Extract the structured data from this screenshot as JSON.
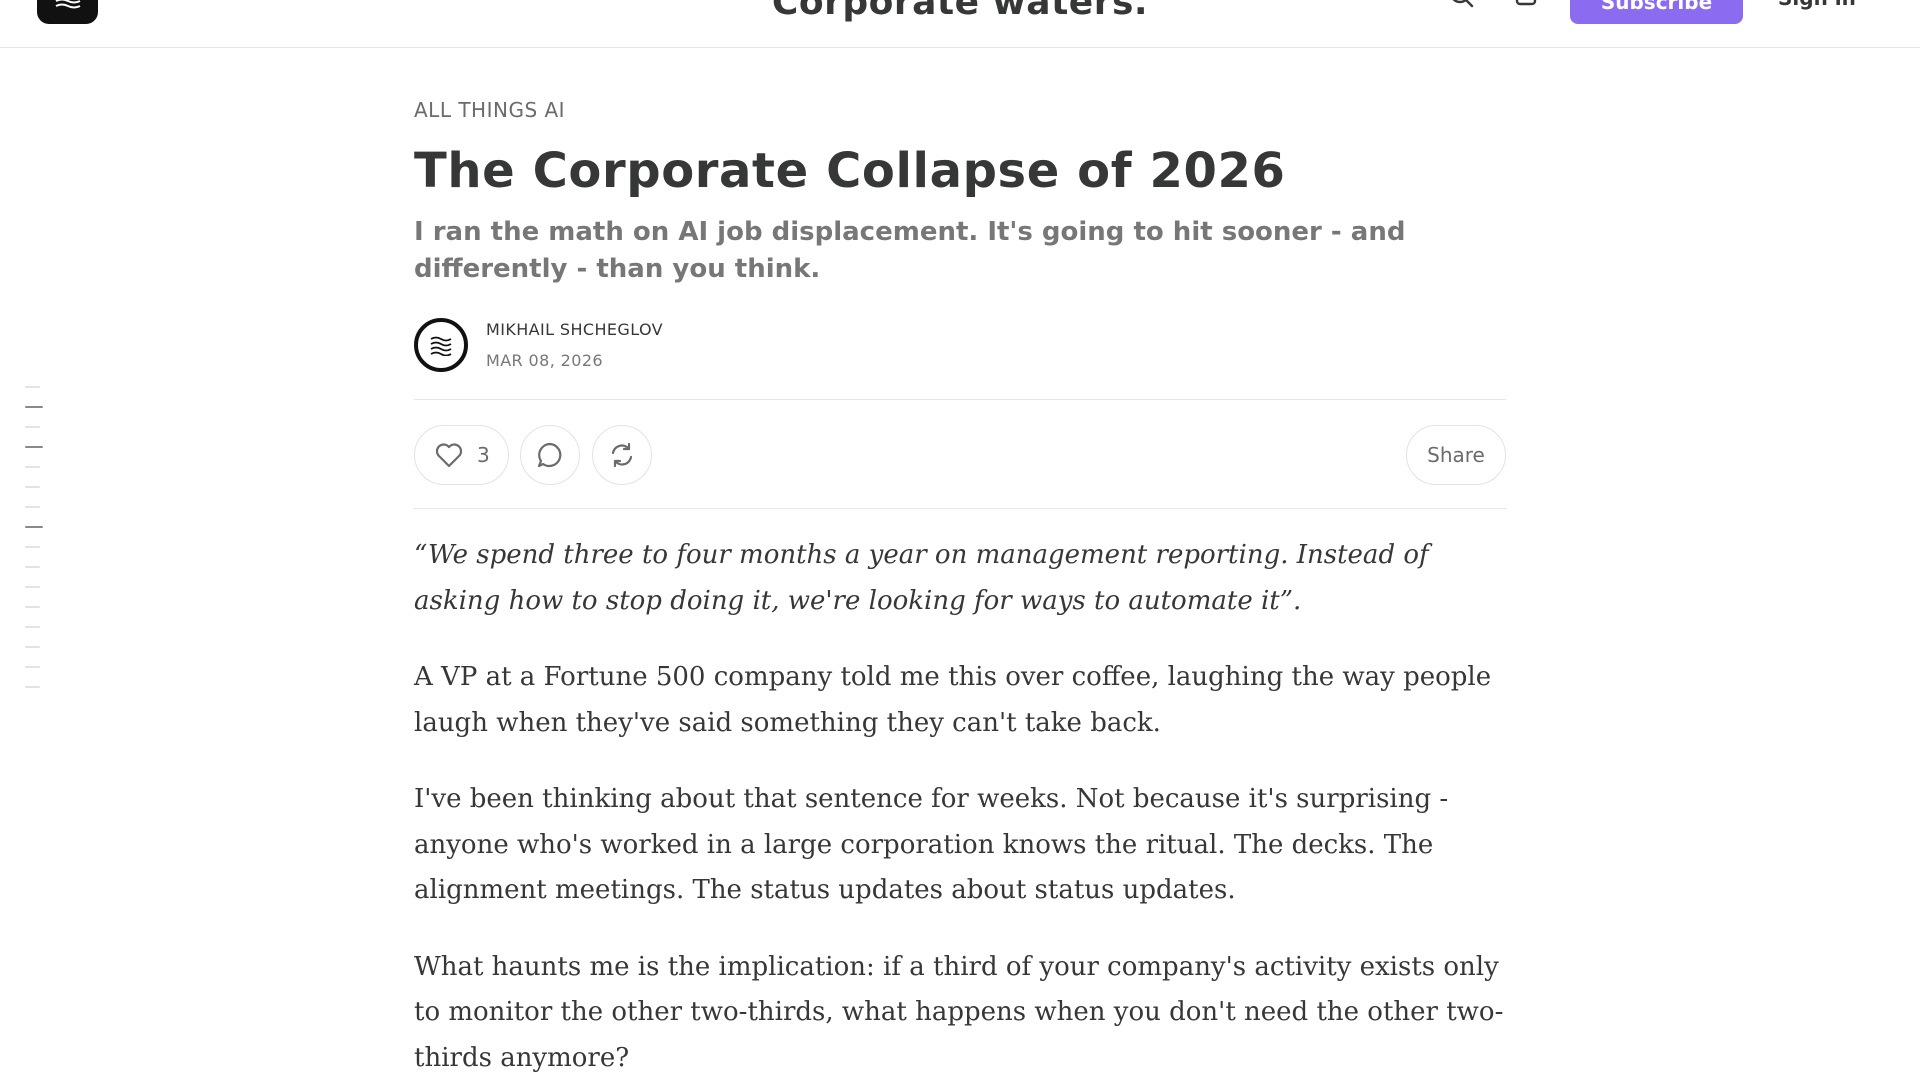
{
  "header": {
    "publication_title": "Corporate waters.",
    "subscribe_label": "Subscribe",
    "signin_label": "Sign in",
    "icons": [
      "waves-logo-icon",
      "search-icon",
      "bag-icon"
    ]
  },
  "toc": {
    "entries": 16,
    "highlighted": [
      1,
      3,
      7
    ]
  },
  "article": {
    "section": "ALL THINGS AI",
    "title": "The Corporate Collapse of 2026",
    "subtitle": "I ran the math on AI job displacement. It's going to hit sooner - and differently - than you think.",
    "author": "MIKHAIL SHCHEGLOV",
    "date": "MAR 08, 2026",
    "likes": "3",
    "share_label": "Share",
    "paragraphs": [
      "“We spend three to four months a year on management reporting. Instead of asking how to stop doing it, we're looking for ways to automate it”.",
      "A VP at a Fortune 500 company told me this over coffee, laughing the way people laugh when they've said something they can't take back.",
      "I've been thinking about that sentence for weeks. Not because it's surprising - anyone who's worked in a large corporation knows the ritual. The decks. The alignment meetings. The status updates about status updates.",
      "What haunts me is the implication: if a third of your company's activity exists only to monitor the other two-thirds, what happens when you don't need the other two-thirds anymore?"
    ]
  },
  "colors": {
    "accent": "#8b6cf0",
    "text": "#363737",
    "muted": "#777777",
    "border": "#e6e6e6"
  }
}
